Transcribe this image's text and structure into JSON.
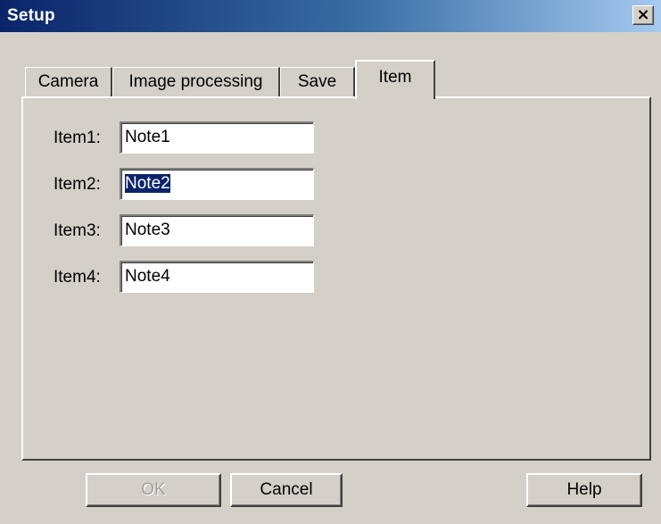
{
  "window": {
    "title": "Setup",
    "close_glyph": "×"
  },
  "tabs": [
    {
      "label": "Camera",
      "active": false
    },
    {
      "label": "Image processing",
      "active": false
    },
    {
      "label": "Save",
      "active": false
    },
    {
      "label": "Item",
      "active": true
    }
  ],
  "items": [
    {
      "label": "Item1:",
      "value": "Note1",
      "selected": false
    },
    {
      "label": "Item2:",
      "value": "Note2",
      "selected": true
    },
    {
      "label": "Item3:",
      "value": "Note3",
      "selected": false
    },
    {
      "label": "Item4:",
      "value": "Note4",
      "selected": false
    }
  ],
  "buttons": {
    "ok": {
      "label": "OK",
      "enabled": false
    },
    "cancel": {
      "label": "Cancel",
      "enabled": true
    },
    "help": {
      "label": "Help",
      "enabled": true
    }
  },
  "colors": {
    "face": "#d4d0c8",
    "title_gradient_start": "#0a246a",
    "title_gradient_end": "#a6caf0",
    "selection": "#0a246a"
  }
}
